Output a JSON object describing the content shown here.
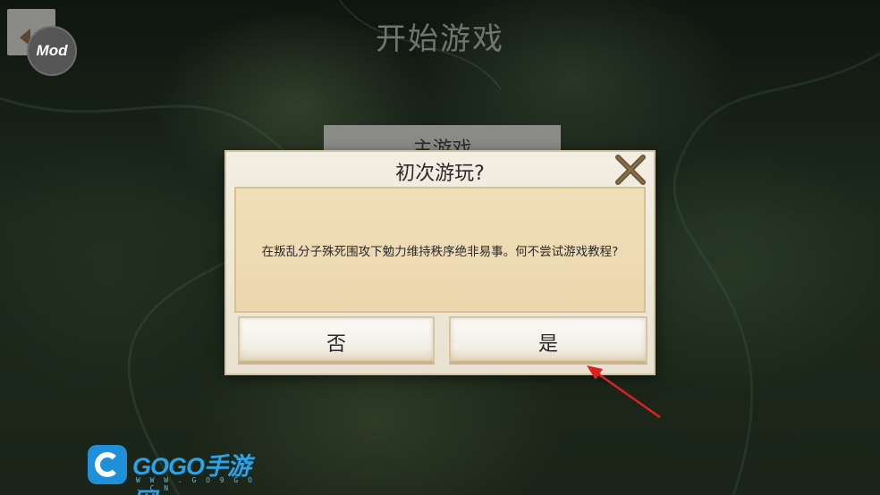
{
  "page": {
    "title": "开始游戏",
    "mod_badge": "Mod",
    "main_game_label": "主游戏"
  },
  "dialog": {
    "title": "初次游玩?",
    "message": "在叛乱分子殊死围攻下勉力维持秩序绝非易事。何不尝试游戏教程?",
    "no_label": "否",
    "yes_label": "是"
  },
  "watermark": {
    "brand": "GOGO手游网",
    "url": "W W W . G O 9 G O . C N"
  },
  "icons": {
    "back": "back-arrow-icon",
    "close": "close-x-icon",
    "annotation": "red-arrow-pointer"
  },
  "colors": {
    "dialog_bg": "#efe9dc",
    "panel_bg": "#eedbb4",
    "close_x": "#6b5536",
    "annotation_arrow": "#e02020",
    "brand_blue": "#2aa3ea"
  }
}
